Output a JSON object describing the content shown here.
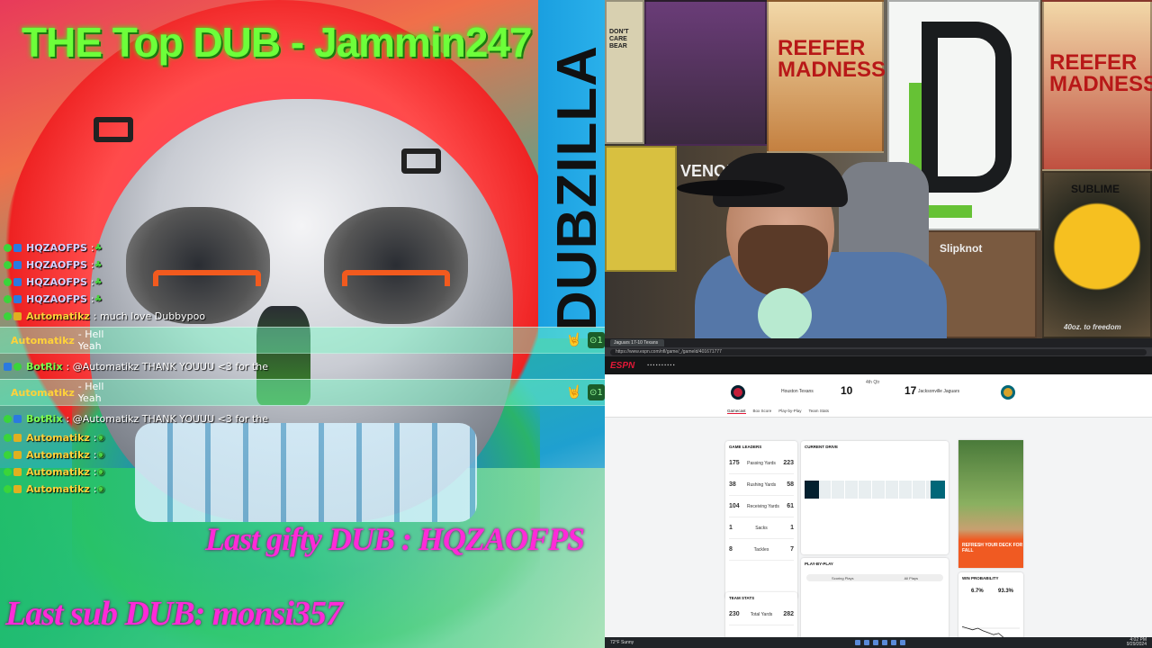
{
  "overlay": {
    "title": "THE Top DUB - Jammin247",
    "banner": "DUBZILLA",
    "last_gift": "Last gifty DUB : HQZAOFPS",
    "last_sub": "Last sub DUB: monsi357"
  },
  "chat": {
    "messages_top": [
      {
        "user": "HQZAOFPS",
        "text": ": ",
        "emote": "leaf-emote"
      },
      {
        "user": "HQZAOFPS",
        "text": ": ",
        "emote": "leaf-emote"
      },
      {
        "user": "HQZAOFPS",
        "text": ": ",
        "emote": "leaf-emote"
      },
      {
        "user": "HQZAOFPS",
        "text": ": ",
        "emote": "leaf-emote"
      },
      {
        "user": "Automatikz",
        "text": ": much love Dubbypoo"
      }
    ],
    "highlight_1": {
      "user": "Automatikz",
      "text": " - Hell Yeah",
      "points": "1"
    },
    "bot_1": {
      "user": "BotRix",
      "text": ": @Automatikz THANK YOUUU <3 for the"
    },
    "highlight_2": {
      "user": "Automatikz",
      "text": " - Hell Yeah",
      "points": "1"
    },
    "bot_2": {
      "user": "BotRix",
      "text": ": @Automatikz THANK YOUUU <3 for the"
    },
    "messages_bottom": [
      {
        "user": "Automatikz",
        "text": ": "
      },
      {
        "user": "Automatikz",
        "text": ": "
      },
      {
        "user": "Automatikz",
        "text": ": "
      },
      {
        "user": "Automatikz",
        "text": ": "
      }
    ]
  },
  "webcam": {
    "posters": {
      "bear": "DON'T CARE BEAR",
      "reefer": "REEFER MADNESS",
      "reefer2": "REEFER MADNESS",
      "sub": "SUBLIME",
      "slipknot": "Slipknot",
      "forty": "40oz. to freedom",
      "venom": "VENOM"
    }
  },
  "browser": {
    "url": "https://www.espn.com/nfl/game/_/gameId/401671777",
    "tab": "Jaguars 17-10 Texans",
    "espn": "ESPN",
    "home_team": "Houston Texans",
    "home_score": "10",
    "away_team": "Jacksonville Jaguars",
    "away_score": "17",
    "game_status": "4th Qtr",
    "subtabs": [
      "Gamecast",
      "Box Score",
      "Play-by-Play",
      "Team Stats"
    ],
    "leaders_title": "Game Leaders",
    "leaders": [
      {
        "cat": "Passing Yards",
        "home": "175",
        "away": "223"
      },
      {
        "cat": "Rushing Yards",
        "home": "38",
        "away": "58"
      },
      {
        "cat": "Receiving Yards",
        "home": "104",
        "away": "61"
      },
      {
        "cat": "Sacks",
        "home": "1",
        "away": "1"
      },
      {
        "cat": "Tackles",
        "home": "8",
        "away": "7"
      }
    ],
    "team_stats_title": "Team Stats",
    "team_stats": {
      "home": "230",
      "label": "Total Yards",
      "away": "282"
    },
    "game_state_title": "Current Drive",
    "play_title": "Play-by-Play",
    "play_tabs": [
      "Scoring Plays",
      "All Plays"
    ],
    "ad_text": "REFRESH YOUR DECK FOR FALL",
    "win_prob_title": "Win Probability",
    "win_prob_home": "6.7%",
    "win_prob_away": "93.3%",
    "win_prob_series": [
      0.55,
      0.5,
      0.45,
      0.5,
      0.42,
      0.36,
      0.3,
      0.34,
      0.2,
      0.15,
      0.1,
      0.07
    ]
  },
  "taskbar": {
    "weather": "72°F Sunny",
    "time": "4:02 PM",
    "date": "9/29/2024"
  }
}
